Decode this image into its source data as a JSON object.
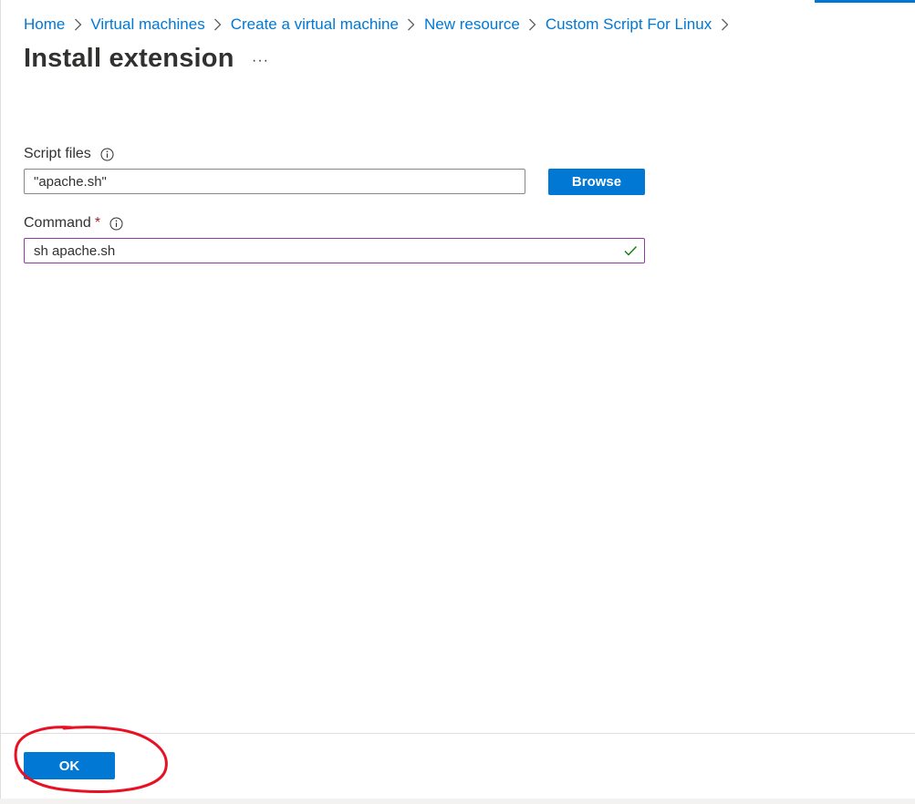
{
  "breadcrumb": {
    "items": [
      {
        "label": "Home"
      },
      {
        "label": "Virtual machines"
      },
      {
        "label": "Create a virtual machine"
      },
      {
        "label": "New resource"
      },
      {
        "label": "Custom Script For Linux"
      }
    ]
  },
  "header": {
    "title": "Install extension",
    "more_label": "···"
  },
  "form": {
    "script_files": {
      "label": "Script files",
      "value": "\"apache.sh\"",
      "browse_label": "Browse"
    },
    "command": {
      "label": "Command",
      "required_mark": "*",
      "value": "sh apache.sh"
    }
  },
  "footer": {
    "ok_label": "OK"
  },
  "colors": {
    "accent": "#0078d4",
    "required": "#a4262c",
    "valid": "#107c10",
    "focus_border": "#8e3c9e",
    "annotation": "#e81123"
  },
  "icons": {
    "info": "info-icon",
    "check": "check-icon",
    "chevron": "chevron-right-icon"
  }
}
